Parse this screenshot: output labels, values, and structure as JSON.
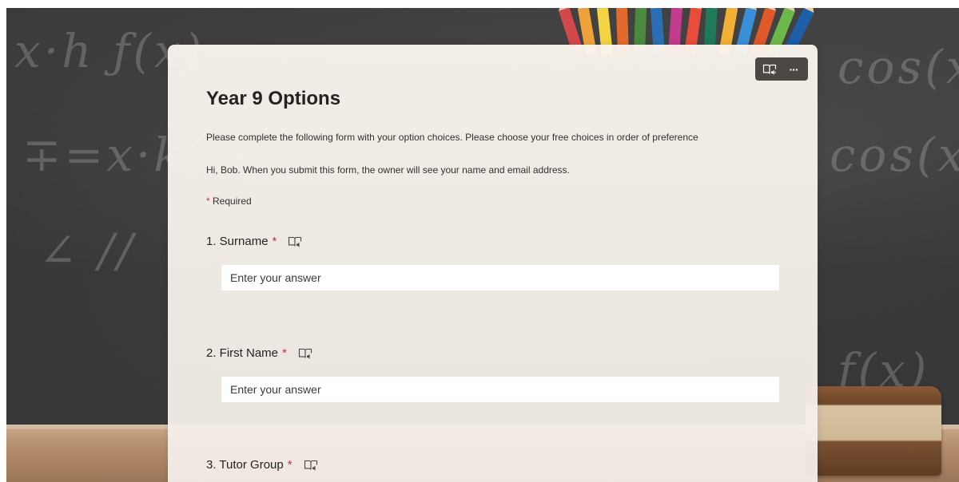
{
  "form": {
    "title": "Year 9 Options",
    "description": "Please complete the following form with your option choices. Please choose your free choices in order of preference",
    "identity_notice": "Hi, Bob. When you submit this form, the owner will see your name and email address.",
    "required_marker": "*",
    "required_label": "Required"
  },
  "toolbar": {
    "icons": [
      "immersive-reader-icon",
      "more-options-icon"
    ],
    "more_glyph": "···"
  },
  "questions": [
    {
      "label": "1. Surname",
      "required": "*",
      "placeholder": "Enter your answer"
    },
    {
      "label": "2. First Name",
      "required": "*",
      "placeholder": "Enter your answer"
    },
    {
      "label": "3. Tutor Group",
      "required": "*"
    }
  ],
  "theme": {
    "accent_required": "#c4314b",
    "toolbar_bg": "#4d4844"
  }
}
